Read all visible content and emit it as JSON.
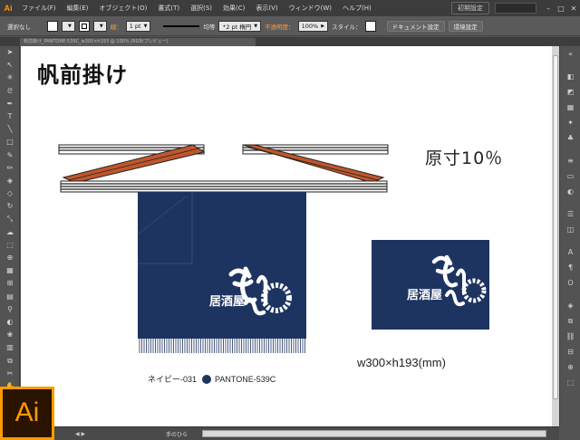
{
  "app": {
    "logo": "Ai",
    "big_logo": "Ai"
  },
  "menu": {
    "items": [
      "ファイル(F)",
      "編集(E)",
      "オブジェクト(O)",
      "書式(T)",
      "選択(S)",
      "効果(C)",
      "表示(V)",
      "ウィンドウ(W)",
      "ヘルプ(H)"
    ],
    "workspace": "初期設定"
  },
  "control": {
    "selection": "選択なし",
    "stroke_label": "線：",
    "stroke_weight": "1 pt",
    "profile": "均等",
    "brush": "2 pt 楕円",
    "opacity_label": "不透明度：",
    "opacity_value": "100%",
    "style_label": "スタイル：",
    "doc_setup": "ドキュメント設定",
    "prefs": "環境設定"
  },
  "tab": {
    "label": "帆前掛け_PANTONE-539C_w300×h193 @ 100% (RGB/プレビュー)"
  },
  "canvas": {
    "title": "帆前掛け",
    "scale": "原寸10％",
    "dims": "w300×h193(mm)",
    "color_name": "ネイビー-031",
    "color_code": "PANTONE-539C",
    "shop_small": "居酒屋",
    "shop_big": "むけ゜ん"
  },
  "status": {
    "tool": "手のひら"
  },
  "colors": {
    "navy": "#1d3461",
    "strap_orange": "#c0562c",
    "accent": "#ff9a00"
  },
  "tools": [
    "selection-arrow",
    "direct-select",
    "magic-wand",
    "lasso",
    "pen",
    "type",
    "line",
    "rectangle",
    "paintbrush",
    "pencil",
    "blob-brush",
    "eraser",
    "rotate",
    "scale",
    "warp",
    "free-transform",
    "shape-builder",
    "perspective",
    "mesh",
    "gradient",
    "eyedropper",
    "blend",
    "symbol-sprayer",
    "column-graph",
    "artboard",
    "slice",
    "hand",
    "zoom"
  ]
}
